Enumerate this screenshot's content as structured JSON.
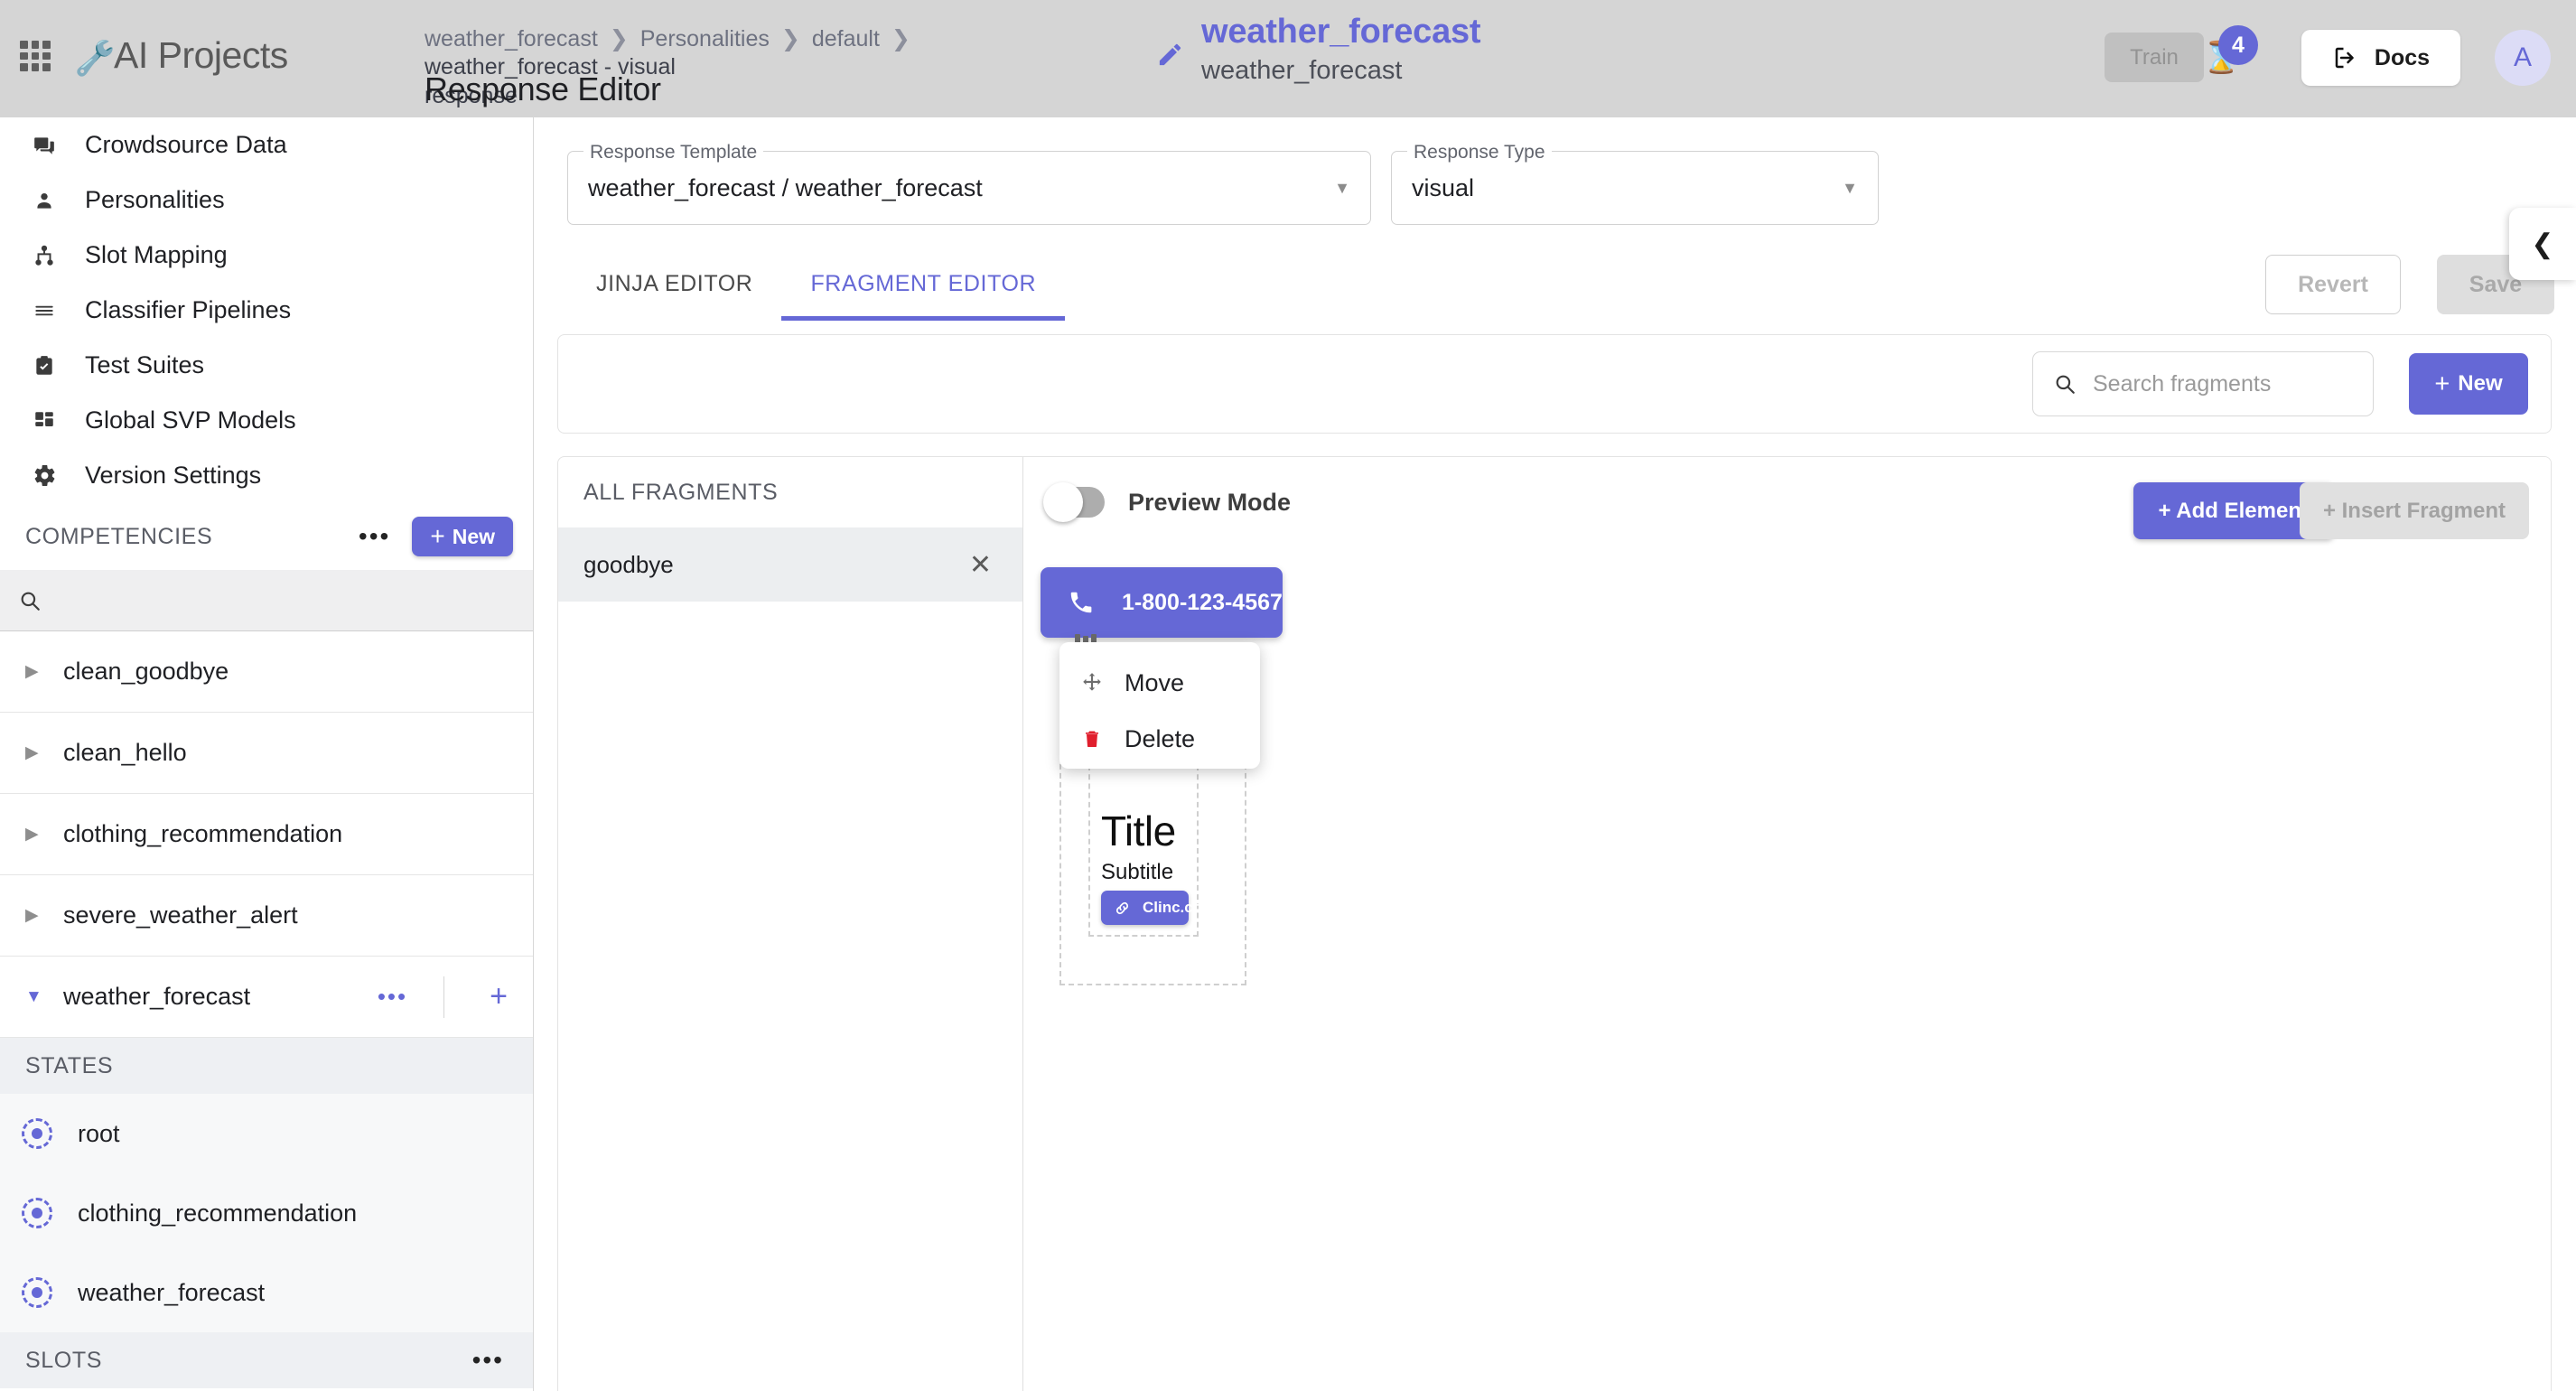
{
  "topbar": {
    "brand": "AI Projects",
    "apps_icon": "grid-apps-icon",
    "wrench_icon": "wrench-icon",
    "breadcrumb": [
      "weather_forecast",
      "Personalities",
      "default",
      "weather_forecast - visual response"
    ],
    "page_title": "Response Editor",
    "entity_title": "weather_forecast",
    "entity_subtitle": "weather_forecast",
    "edit_icon": "pencil-icon",
    "train_label": "Train",
    "notification_count": "4",
    "notification_icon": "hourglass-icon",
    "docs_label": "Docs",
    "docs_icon": "exit-to-app-icon",
    "avatar_initial": "A"
  },
  "sidebar": {
    "nav": [
      {
        "label": "Crowdsource Data",
        "icon": "forum-icon"
      },
      {
        "label": "Personalities",
        "icon": "person-icon"
      },
      {
        "label": "Slot Mapping",
        "icon": "account-tree-icon"
      },
      {
        "label": "Classifier Pipelines",
        "icon": "reorder-icon"
      },
      {
        "label": "Test Suites",
        "icon": "assignment-turned-in-icon"
      },
      {
        "label": "Global SVP Models",
        "icon": "dashboard-icon"
      },
      {
        "label": "Version Settings",
        "icon": "gear-icon"
      }
    ],
    "competencies_header": "COMPETENCIES",
    "competencies_more_icon": "more-horizontal-icon",
    "competencies_new_label": "New",
    "search_icon": "search-icon",
    "search_value": "",
    "competencies": [
      {
        "label": "clean_goodbye",
        "expanded": false
      },
      {
        "label": "clean_hello",
        "expanded": false
      },
      {
        "label": "clothing_recommendation",
        "expanded": false
      },
      {
        "label": "severe_weather_alert",
        "expanded": false
      },
      {
        "label": "weather_forecast",
        "expanded": true
      }
    ],
    "states_header": "STATES",
    "states": [
      {
        "label": "root",
        "icon": "state-node-icon"
      },
      {
        "label": "clothing_recommendation",
        "icon": "state-node-icon"
      },
      {
        "label": "weather_forecast",
        "icon": "state-node-icon"
      }
    ],
    "slots_header": "SLOTS",
    "slots_more_icon": "more-horizontal-icon"
  },
  "main": {
    "response_template": {
      "legend": "Response Template",
      "value": "weather_forecast / weather_forecast"
    },
    "response_type": {
      "legend": "Response Type",
      "value": "visual"
    },
    "tabs": [
      {
        "label": "JINJA EDITOR",
        "active": false
      },
      {
        "label": "FRAGMENT EDITOR",
        "active": true
      }
    ],
    "revert_label": "Revert",
    "save_label": "Save",
    "collapse_icon": "chevron-left-icon",
    "fragment_search": {
      "placeholder": "Search fragments",
      "value": "",
      "icon": "search-icon"
    },
    "new_fragment_label": "New",
    "fragment_panel": {
      "header": "ALL FRAGMENTS",
      "items": [
        {
          "label": "goodbye",
          "close_icon": "close-icon"
        }
      ]
    },
    "canvas": {
      "preview_mode_label": "Preview Mode",
      "preview_mode_on": false,
      "add_element_label": "+ Add Element",
      "insert_fragment_label": "+ Insert Fragment",
      "phone_button": {
        "label": "1-800-123-4567",
        "icon": "phone-icon"
      },
      "context_menu": [
        {
          "label": "Move",
          "icon": "move-icon"
        },
        {
          "label": "Delete",
          "icon": "trash-icon"
        }
      ],
      "card": {
        "title": "Title",
        "subtitle": "Subtitle",
        "link_button": {
          "label": "Clinc.com",
          "icon": "link-icon"
        }
      }
    }
  },
  "colors": {
    "accent": "#6568d6",
    "topbar_bg": "#d5d5d5",
    "danger": "#e01f2d",
    "muted_text": "#9a9a9a"
  }
}
